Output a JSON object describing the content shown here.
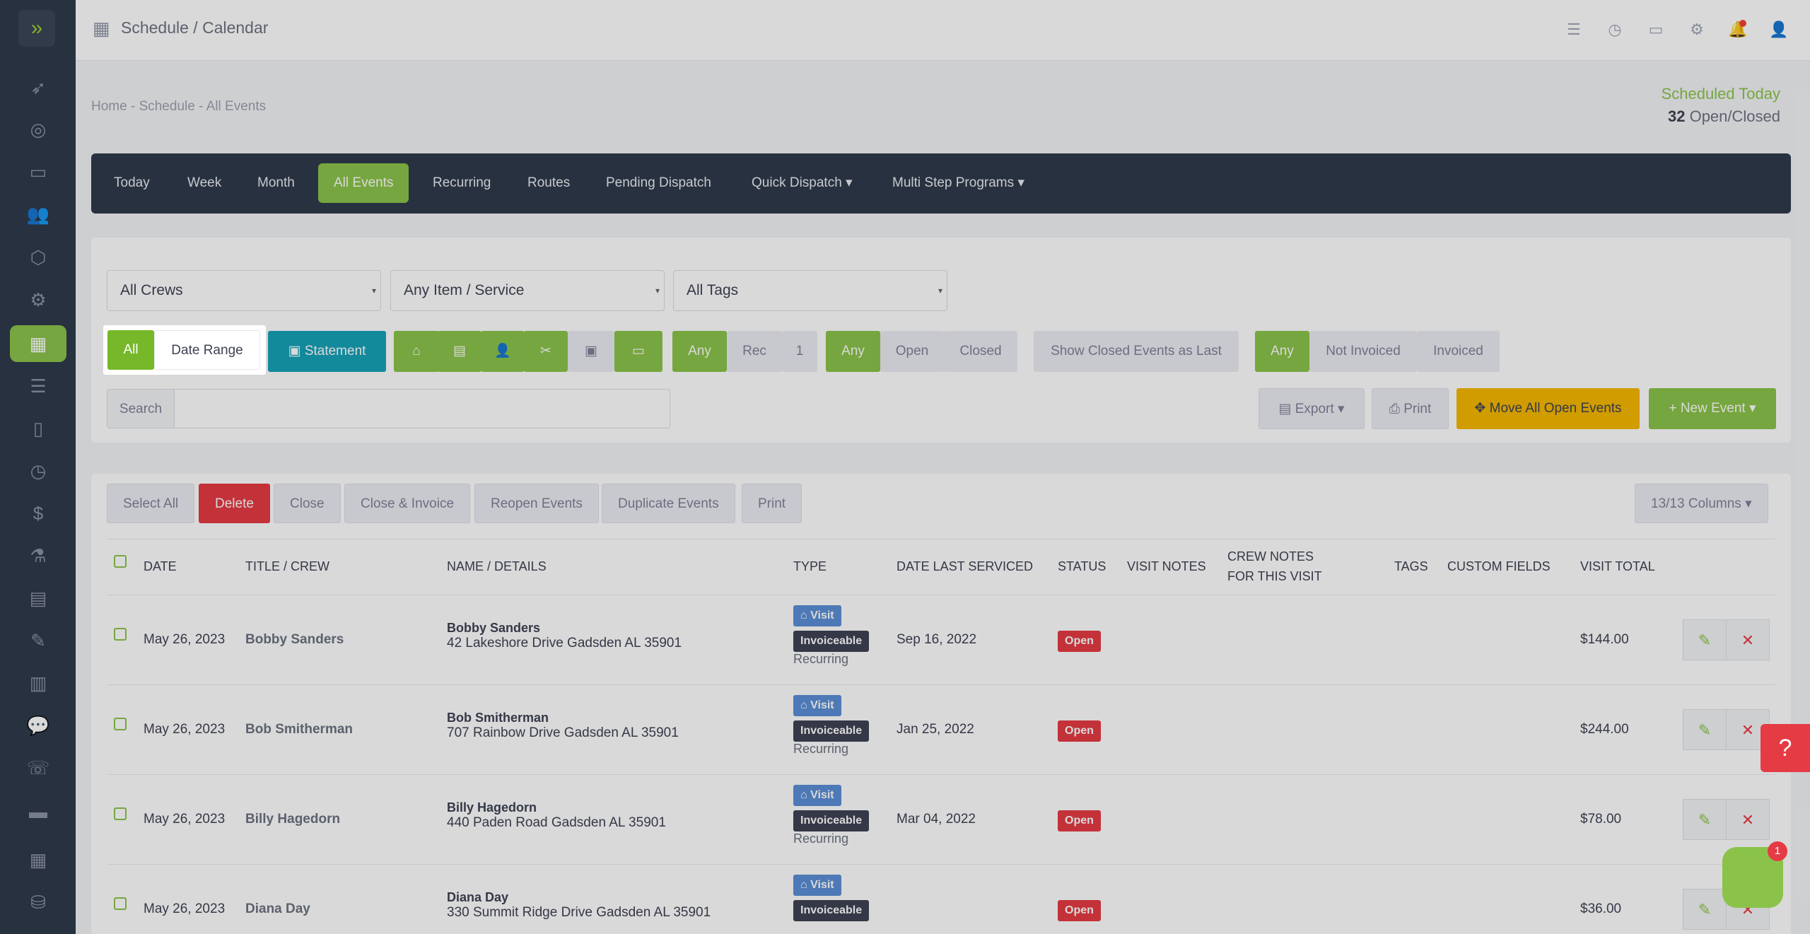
{
  "header": {
    "title": "Schedule / Calendar"
  },
  "breadcrumb": "Home  -  Schedule  -  All Events",
  "scheduled_today": {
    "label": "Scheduled Today",
    "count": "32",
    "suffix": "Open/Closed"
  },
  "nav": {
    "tabs": [
      "Today",
      "Week",
      "Month",
      "All Events",
      "Recurring",
      "Routes",
      "Pending Dispatch",
      "Quick Dispatch ▾",
      "Multi Step Programs ▾"
    ],
    "active": "All Events"
  },
  "filters": {
    "crews": "All Crews",
    "items": "Any Item / Service",
    "tags": "All Tags",
    "range_all": "All",
    "range_date": "Date Range",
    "statement": "Statement",
    "any1": "Any",
    "rec": "Rec",
    "one": "1",
    "any2": "Any",
    "open": "Open",
    "closed": "Closed",
    "show_closed": "Show Closed Events as Last",
    "any3": "Any",
    "not_invoiced": "Not Invoiced",
    "invoiced": "Invoiced",
    "search_label": "Search",
    "export": "Export ▾",
    "print": "Print",
    "move_all": "Move All Open Events",
    "new_event": "+ New Event ▾"
  },
  "actions": {
    "select_all": "Select All",
    "delete": "Delete",
    "close": "Close",
    "close_invoice": "Close & Invoice",
    "reopen": "Reopen Events",
    "duplicate": "Duplicate Events",
    "print": "Print",
    "columns": "13/13 Columns ▾"
  },
  "table": {
    "headers": {
      "date": "DATE",
      "title": "TITLE / CREW",
      "name": "NAME / DETAILS",
      "type": "TYPE",
      "last": "DATE LAST SERVICED",
      "status": "STATUS",
      "visit_notes": "VISIT NOTES",
      "crew_notes_1": "CREW NOTES",
      "crew_notes_2": "FOR THIS VISIT",
      "tags": "TAGS",
      "custom": "CUSTOM FIELDS",
      "total": "VISIT TOTAL"
    },
    "rows": [
      {
        "date": "May 26, 2023",
        "crew": "Bobby Sanders",
        "name": "Bobby Sanders",
        "addr": "42 Lakeshore Drive Gadsden AL 35901",
        "visit": "Visit",
        "inv": "Invoiceable",
        "rec": "Recurring",
        "last": "Sep 16, 2022",
        "status": "Open",
        "total": "$144.00"
      },
      {
        "date": "May 26, 2023",
        "crew": "Bob Smitherman",
        "name": "Bob Smitherman",
        "addr": "707 Rainbow Drive Gadsden AL 35901",
        "visit": "Visit",
        "inv": "Invoiceable",
        "rec": "Recurring",
        "last": "Jan 25, 2022",
        "status": "Open",
        "total": "$244.00"
      },
      {
        "date": "May 26, 2023",
        "crew": "Billy Hagedorn",
        "name": "Billy Hagedorn",
        "addr": "440 Paden Road Gadsden AL 35901",
        "visit": "Visit",
        "inv": "Invoiceable",
        "rec": "Recurring",
        "last": "Mar 04, 2022",
        "status": "Open",
        "total": "$78.00"
      },
      {
        "date": "May 26, 2023",
        "crew": "Diana Day",
        "name": "Diana Day",
        "addr": "330 Summit Ridge Drive Gadsden AL 35901",
        "visit": "Visit",
        "inv": "Invoiceable",
        "rec": "",
        "last": "",
        "status": "Open",
        "total": "$36.00"
      }
    ]
  },
  "chat": {
    "count": "1"
  }
}
